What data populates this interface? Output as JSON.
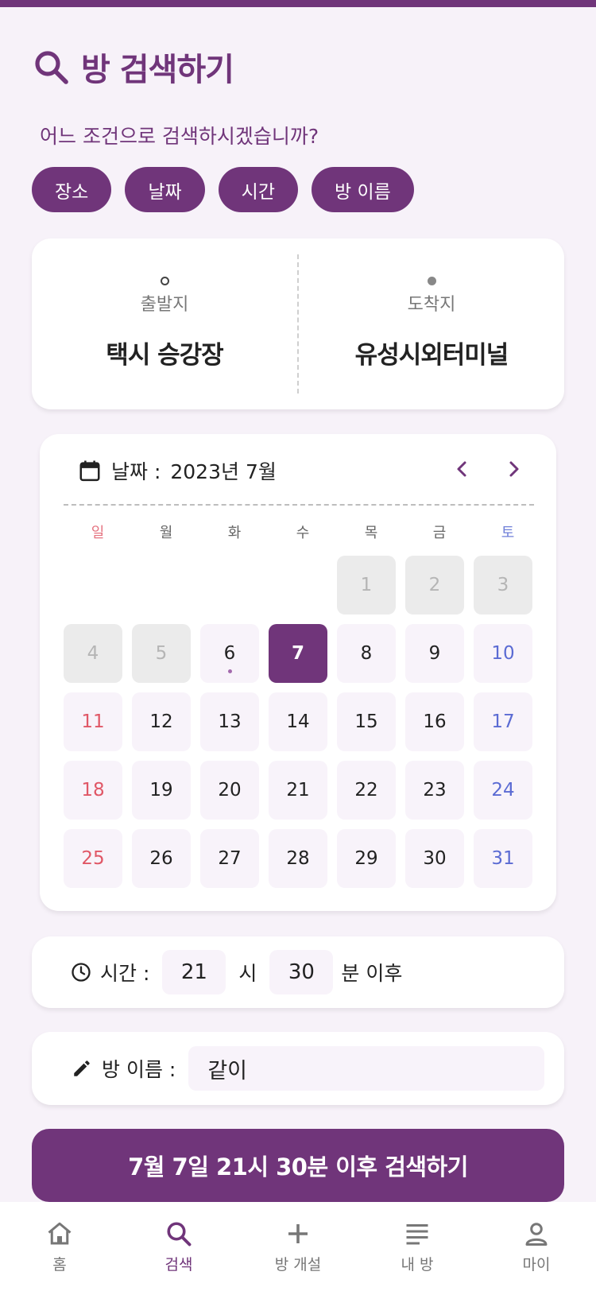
{
  "colors": {
    "primary": "#70357a",
    "sunday": "#e05766",
    "saturday": "#5b6bd3"
  },
  "header": {
    "title": "방 검색하기",
    "icon": "search-icon"
  },
  "question": "어느 조건으로 검색하시겠습니까?",
  "chips": [
    {
      "label": "장소"
    },
    {
      "label": "날짜"
    },
    {
      "label": "시간"
    },
    {
      "label": "방 이름"
    }
  ],
  "route": {
    "departure_label": "출발지",
    "departure": "택시 승강장",
    "arrival_label": "도착지",
    "arrival": "유성시외터미널"
  },
  "calendar": {
    "label": "날짜 :",
    "month": "2023년 7월",
    "weekdays": [
      "일",
      "월",
      "화",
      "수",
      "목",
      "금",
      "토"
    ],
    "days": [
      {
        "n": "",
        "state": "empty"
      },
      {
        "n": "",
        "state": "empty"
      },
      {
        "n": "",
        "state": "empty"
      },
      {
        "n": "",
        "state": "empty"
      },
      {
        "n": "1",
        "state": "past"
      },
      {
        "n": "2",
        "state": "past"
      },
      {
        "n": "3",
        "state": "past"
      },
      {
        "n": "4",
        "state": "past"
      },
      {
        "n": "5",
        "state": "past"
      },
      {
        "n": "6",
        "state": "today"
      },
      {
        "n": "7",
        "state": "selected"
      },
      {
        "n": "8",
        "state": ""
      },
      {
        "n": "9",
        "state": ""
      },
      {
        "n": "10",
        "state": "sat"
      },
      {
        "n": "11",
        "state": "sun"
      },
      {
        "n": "12",
        "state": ""
      },
      {
        "n": "13",
        "state": ""
      },
      {
        "n": "14",
        "state": ""
      },
      {
        "n": "15",
        "state": ""
      },
      {
        "n": "16",
        "state": ""
      },
      {
        "n": "17",
        "state": "sat"
      },
      {
        "n": "18",
        "state": "sun"
      },
      {
        "n": "19",
        "state": ""
      },
      {
        "n": "20",
        "state": ""
      },
      {
        "n": "21",
        "state": ""
      },
      {
        "n": "22",
        "state": ""
      },
      {
        "n": "23",
        "state": ""
      },
      {
        "n": "24",
        "state": "sat"
      },
      {
        "n": "25",
        "state": "sun"
      },
      {
        "n": "26",
        "state": ""
      },
      {
        "n": "27",
        "state": ""
      },
      {
        "n": "28",
        "state": ""
      },
      {
        "n": "29",
        "state": ""
      },
      {
        "n": "30",
        "state": ""
      },
      {
        "n": "31",
        "state": "sat"
      }
    ]
  },
  "time": {
    "label": "시간 :",
    "hour": "21",
    "hour_unit": "시",
    "minute": "30",
    "minute_unit": "분 이후"
  },
  "room_name": {
    "label": "방 이름 :",
    "value": "같이"
  },
  "search_button": "7월 7일 21시 30분 이후 검색하기",
  "bottom_nav": [
    {
      "label": "홈",
      "icon": "home-icon",
      "active": false
    },
    {
      "label": "검색",
      "icon": "search-icon",
      "active": true
    },
    {
      "label": "방 개설",
      "icon": "plus-icon",
      "active": false
    },
    {
      "label": "내 방",
      "icon": "list-icon",
      "active": false
    },
    {
      "label": "마이",
      "icon": "person-icon",
      "active": false
    }
  ]
}
